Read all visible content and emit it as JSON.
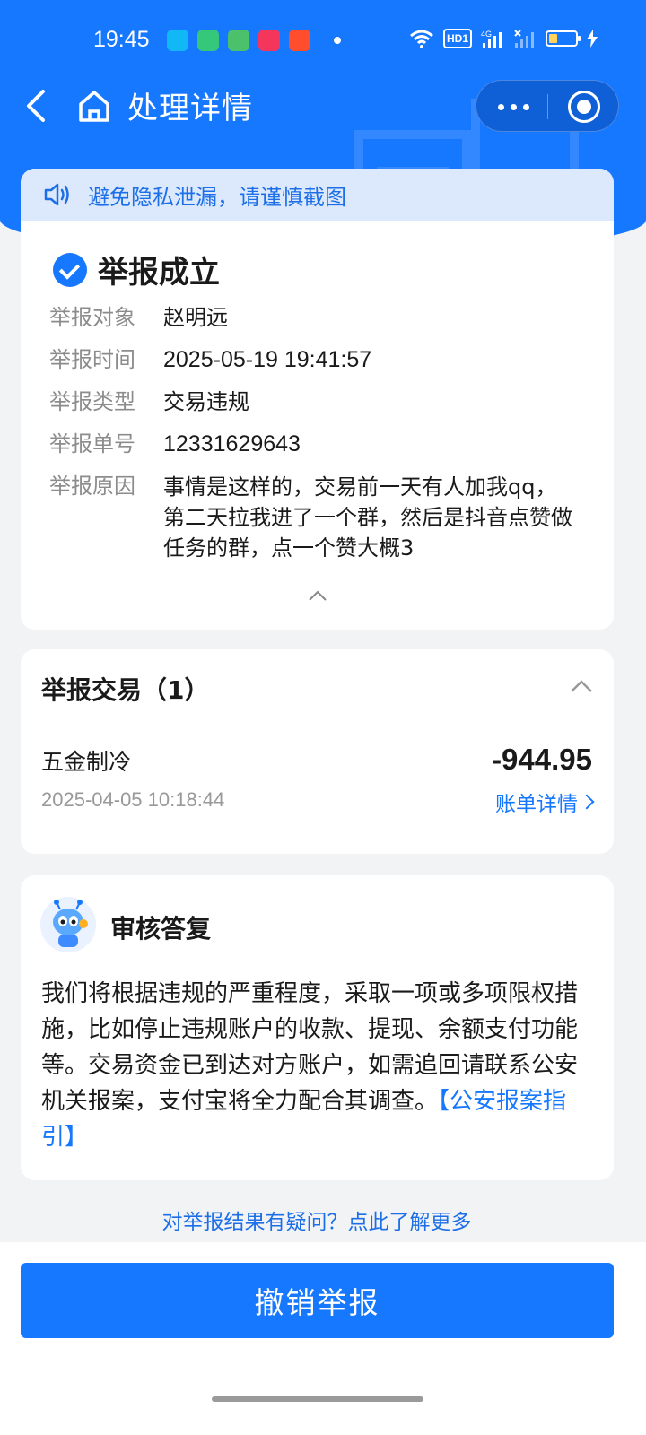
{
  "status_bar": {
    "time": "19:45",
    "network": "4G",
    "hd": "HD1",
    "apps": [
      {
        "name": "qq-icon",
        "color": "#12b7f5"
      },
      {
        "name": "phone-icon",
        "color": "#35c77a"
      },
      {
        "name": "messages-icon",
        "color": "#4cc16b"
      },
      {
        "name": "music-icon",
        "color": "#f5365c"
      },
      {
        "name": "video-icon",
        "color": "#ff4d2e"
      }
    ]
  },
  "nav": {
    "title": "处理详情"
  },
  "notice": {
    "text": "避免隐私泄漏，请谨慎截图"
  },
  "report": {
    "status": "举报成立",
    "fields": [
      {
        "label": "举报对象",
        "value": "赵明远"
      },
      {
        "label": "举报时间",
        "value": "2025-05-19 19:41:57"
      },
      {
        "label": "举报类型",
        "value": "交易违规"
      },
      {
        "label": "举报单号",
        "value": "12331629643"
      }
    ],
    "reason_label": "举报原因",
    "reason_text": "事情是这样的，交易前一天有人加我qq，第二天拉我进了一个群，然后是抖音点赞做任务的群，点一个赞大概3"
  },
  "trade": {
    "title": "举报交易（1）",
    "item": {
      "name": "五金制冷",
      "amount": "-944.95",
      "time": "2025-04-05 10:18:44",
      "link": "账单详情"
    }
  },
  "review": {
    "title": "审核答复",
    "body": "我们将根据违规的严重程度，采取一项或多项限权措施，比如停止违规账户的收款、提现、余额支付功能等。交易资金已到达对方账户，如需追回请联系公安机关报案，支付宝将全力配合其调查。",
    "link": "【公安报案指引】"
  },
  "question_link": "对举报结果有疑问？点此了解更多",
  "cancel_button": "撤销举报",
  "colors": {
    "brand": "#1677ff",
    "notice_bg": "#dce9fd"
  }
}
